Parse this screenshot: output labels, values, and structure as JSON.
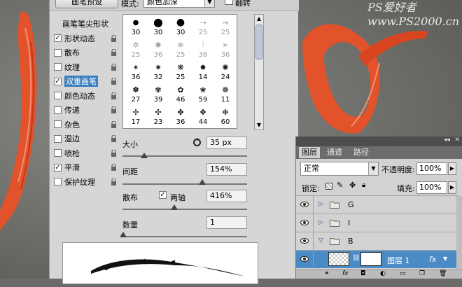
{
  "watermark": "PS爱好者 www.PS2000.cn",
  "brush_panel": {
    "preset_button": "画笔预设",
    "mode_label": "模式:",
    "mode_value": "颜色加深",
    "flip_label": "翻转",
    "header": "画笔笔尖形状",
    "options": [
      {
        "label": "形状动态",
        "checked": true
      },
      {
        "label": "散布",
        "checked": false
      },
      {
        "label": "纹理",
        "checked": false
      },
      {
        "label": "双重画笔",
        "checked": true,
        "selected": true
      },
      {
        "label": "颜色动态",
        "checked": false
      },
      {
        "label": "传递",
        "checked": false
      },
      {
        "label": "杂色",
        "checked": false
      },
      {
        "label": "湿边",
        "checked": false
      },
      {
        "label": "喷枪",
        "checked": false
      },
      {
        "label": "平滑",
        "checked": true
      },
      {
        "label": "保护纹理",
        "checked": false
      }
    ],
    "brush_sizes": [
      [
        "30",
        "30",
        "30",
        "25",
        "25"
      ],
      [
        "25",
        "36",
        "25",
        "36",
        "36"
      ],
      [
        "36",
        "32",
        "25",
        "14",
        "24"
      ],
      [
        "27",
        "39",
        "46",
        "59",
        "11"
      ],
      [
        "17",
        "23",
        "36",
        "44",
        "60"
      ]
    ],
    "size_label": "大小",
    "size_value": "35 px",
    "spacing_label": "间距",
    "spacing_value": "154%",
    "scatter_label": "散布",
    "both_axes_label": "两轴",
    "scatter_value": "416%",
    "count_label": "数量",
    "count_value": "1"
  },
  "layers_panel": {
    "tabs": [
      "图层",
      "通道",
      "路径"
    ],
    "blend_mode": "正常",
    "opacity_label": "不透明度:",
    "opacity_value": "100%",
    "lock_label": "锁定:",
    "fill_label": "填充:",
    "fill_value": "100%",
    "layers": [
      {
        "name": "G",
        "type": "group",
        "expanded": false
      },
      {
        "name": "I",
        "type": "group",
        "expanded": false
      },
      {
        "name": "B",
        "type": "group",
        "expanded": true
      },
      {
        "name": "图层 1",
        "type": "layer",
        "selected": true
      }
    ]
  }
}
